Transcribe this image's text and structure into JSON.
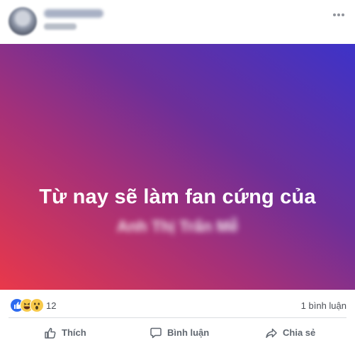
{
  "post": {
    "text_line1": "Từ nay sẽ làm fan cứng của",
    "text_line2": "Anh Thị Trấn Mễ"
  },
  "reactions": {
    "types": [
      "like-icon",
      "haha-icon",
      "wow-icon"
    ],
    "count": "12"
  },
  "comments": {
    "count_label": "1 bình luận"
  },
  "actions": {
    "like_label": "Thích",
    "comment_label": "Bình luận",
    "share_label": "Chia sẻ"
  },
  "colors": {
    "gradient_top_right": "#3d33c8",
    "gradient_bottom_left": "#e9384a",
    "like_blue": "#2e6bf0",
    "action_gray": "#606770"
  }
}
